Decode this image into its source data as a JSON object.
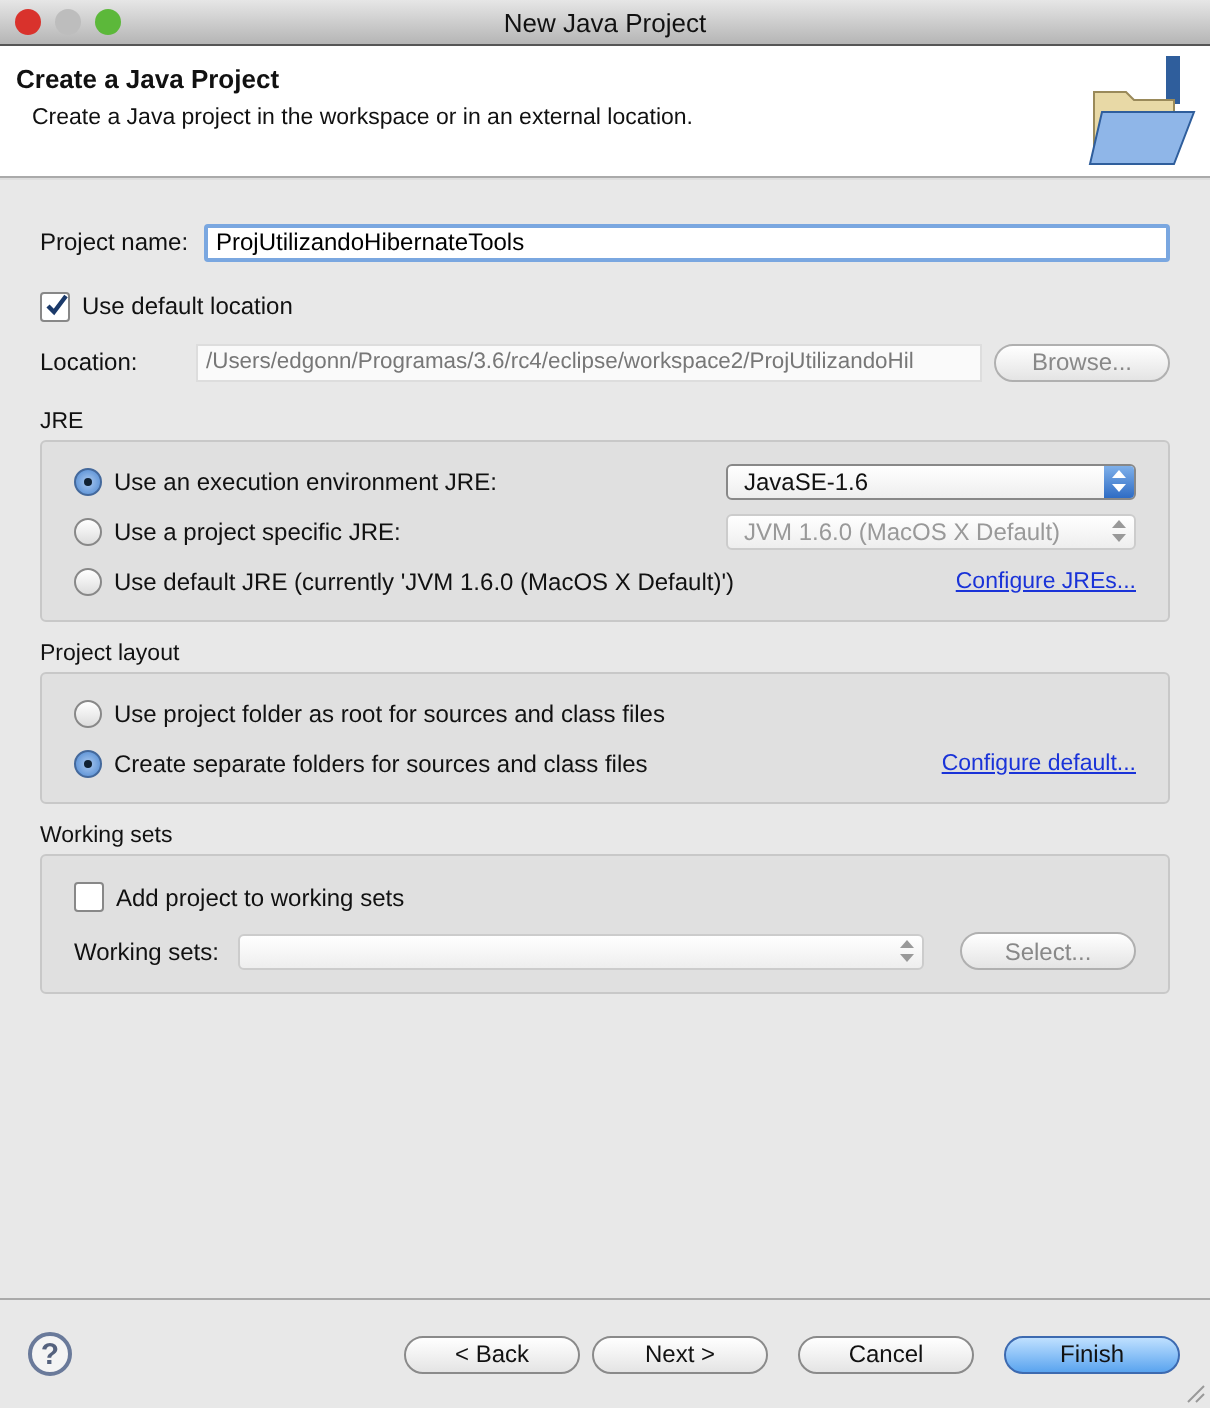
{
  "window": {
    "title": "New Java Project"
  },
  "header": {
    "title": "Create a Java Project",
    "description": "Create a Java project in the workspace or in an external location."
  },
  "project_name": {
    "label": "Project name:",
    "value": "ProjUtilizandoHibernateTools"
  },
  "use_default_location": {
    "label": "Use default location",
    "checked": true
  },
  "location": {
    "label": "Location:",
    "value": "/Users/edgonn/Programas/3.6/rc4/eclipse/workspace2/ProjUtilizandoHil",
    "disabled": true,
    "browse": {
      "label": "Browse...",
      "disabled": true
    }
  },
  "jre": {
    "title": "JRE",
    "options": [
      {
        "label": "Use an execution environment JRE:",
        "selected": true,
        "combo": {
          "value": "JavaSE-1.6",
          "disabled": false
        }
      },
      {
        "label": "Use a project specific JRE:",
        "selected": false,
        "combo": {
          "value": "JVM 1.6.0 (MacOS X Default)",
          "disabled": true
        }
      },
      {
        "label": "Use default JRE (currently 'JVM 1.6.0 (MacOS X Default)')",
        "selected": false,
        "link": "Configure JREs..."
      }
    ]
  },
  "project_layout": {
    "title": "Project layout",
    "options": [
      {
        "label": "Use project folder as root for sources and class files",
        "selected": false
      },
      {
        "label": "Create separate folders for sources and class files",
        "selected": true,
        "link": "Configure default..."
      }
    ]
  },
  "working_sets": {
    "title": "Working sets",
    "add": {
      "label": "Add project to working sets",
      "checked": false
    },
    "label": "Working sets:",
    "combo": {
      "disabled": true
    },
    "select": {
      "label": "Select...",
      "disabled": true
    }
  },
  "help": {
    "glyph": "?"
  },
  "buttons": [
    {
      "label": "< Back",
      "default": false,
      "disabled": false
    },
    {
      "label": "Next >",
      "default": false,
      "disabled": false
    },
    {
      "label": "Cancel",
      "default": false,
      "disabled": false
    },
    {
      "label": "Finish",
      "default": true,
      "disabled": false
    }
  ]
}
